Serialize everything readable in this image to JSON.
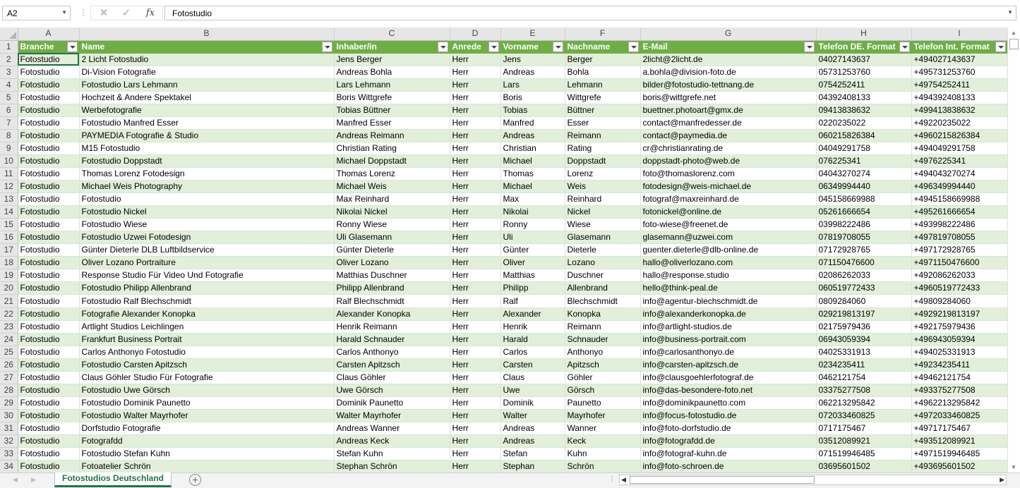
{
  "namebox": {
    "value": "A2"
  },
  "formula_bar": {
    "fx_label": "fx",
    "cancel_glyph": "✕",
    "enter_glyph": "✓",
    "value": "Fotostudio"
  },
  "columns": [
    "A",
    "B",
    "C",
    "D",
    "E",
    "F",
    "G",
    "H",
    "I"
  ],
  "header_row_number": "1",
  "headers": [
    "Branche",
    "Name",
    "Inhaber/in",
    "Anrede",
    "Vorname",
    "Nachname",
    "E-Mail",
    "Telefon DE. Format",
    "Telefon Int. Format"
  ],
  "rows": [
    {
      "n": "2",
      "c": [
        "Fotostudio",
        "2 Licht Fotostudio",
        "Jens Berger",
        "Herr",
        "Jens",
        "Berger",
        "2licht@2licht.de",
        "04027143637",
        "+494027143637"
      ]
    },
    {
      "n": "3",
      "c": [
        "Fotostudio",
        "Di-Vision Fotografie",
        "Andreas Bohla",
        "Herr",
        "Andreas",
        "Bohla",
        "a.bohla@division-foto.de",
        "05731253760",
        "+495731253760"
      ]
    },
    {
      "n": "4",
      "c": [
        "Fotostudio",
        "Fotostudio Lars Lehmann",
        "Lars Lehmann",
        "Herr",
        "Lars",
        "Lehmann",
        "bilder@fotostudio-tettnang.de",
        "0754252411",
        "+49754252411"
      ]
    },
    {
      "n": "5",
      "c": [
        "Fotostudio",
        "Hochzeit & Andere Spektakel",
        "Boris Wittgrefe",
        "Herr",
        "Boris",
        "Wittgrefe",
        "boris@wittgrefe.net",
        "04392408133",
        "+494392408133"
      ]
    },
    {
      "n": "6",
      "c": [
        "Fotostudio",
        "Werbefotografie",
        "Tobias Büttner",
        "Herr",
        "Tobias",
        "Büttner",
        "buettner.photoart@gmx.de",
        "09413838632",
        "+499413838632"
      ]
    },
    {
      "n": "7",
      "c": [
        "Fotostudio",
        "Fotostudio Manfred Esser",
        "Manfred Esser",
        "Herr",
        "Manfred",
        "Esser",
        "contact@manfredesser.de",
        "0220235022",
        "+49220235022"
      ]
    },
    {
      "n": "8",
      "c": [
        "Fotostudio",
        "PAYMEDIA Fotografie & Studio",
        "Andreas Reimann",
        "Herr",
        "Andreas",
        "Reimann",
        "contact@paymedia.de",
        "060215826384",
        "+4960215826384"
      ]
    },
    {
      "n": "9",
      "c": [
        "Fotostudio",
        "M15 Fotostudio",
        "Christian Rating",
        "Herr",
        "Christian",
        "Rating",
        "cr@christianrating.de",
        "04049291758",
        "+494049291758"
      ]
    },
    {
      "n": "10",
      "c": [
        "Fotostudio",
        "Fotostudio Doppstadt",
        "Michael Doppstadt",
        "Herr",
        "Michael",
        "Doppstadt",
        "doppstadt-photo@web.de",
        "076225341",
        "+4976225341"
      ]
    },
    {
      "n": "11",
      "c": [
        "Fotostudio",
        "Thomas Lorenz Fotodesign",
        "Thomas Lorenz",
        "Herr",
        "Thomas",
        "Lorenz",
        "foto@thomaslorenz.com",
        "04043270274",
        "+494043270274"
      ]
    },
    {
      "n": "12",
      "c": [
        "Fotostudio",
        "Michael Weis Photography",
        "Michael Weis",
        "Herr",
        "Michael",
        "Weis",
        "fotodesign@weis-michael.de",
        "06349994440",
        "+496349994440"
      ]
    },
    {
      "n": "13",
      "c": [
        "Fotostudio",
        "Fotostudio",
        "Max Reinhard",
        "Herr",
        "Max",
        "Reinhard",
        "fotograf@maxreinhard.de",
        "045158669988",
        "+4945158669988"
      ]
    },
    {
      "n": "14",
      "c": [
        "Fotostudio",
        "Fotostudio Nickel",
        "Nikolai Nickel",
        "Herr",
        "Nikolai",
        "Nickel",
        "fotonickel@online.de",
        "05261666654",
        "+495261666654"
      ]
    },
    {
      "n": "15",
      "c": [
        "Fotostudio",
        "Fotostudio Wiese",
        "Ronny Wiese",
        "Herr",
        "Ronny",
        "Wiese",
        "foto-wiese@freenet.de",
        "03998222486",
        "+493998222486"
      ]
    },
    {
      "n": "16",
      "c": [
        "Fotostudio",
        "Fotostudio Uzwei Fotodesign",
        "Uli Glasemann",
        "Herr",
        "Uli",
        "Glasemann",
        "glasemann@uzwei.com",
        "07819708055",
        "+497819708055"
      ]
    },
    {
      "n": "17",
      "c": [
        "Fotostudio",
        "Günter Dieterle DLB Luftbildservice",
        "Günter Dieterle",
        "Herr",
        "Günter",
        "Dieterle",
        "guenter.dieterle@dlb-online.de",
        "07172928765",
        "+497172928765"
      ]
    },
    {
      "n": "18",
      "c": [
        "Fotostudio",
        "Oliver Lozano Portraiture",
        "Oliver Lozano",
        "Herr",
        "Oliver",
        "Lozano",
        "hallo@oliverlozano.com",
        "071150476600",
        "+4971150476600"
      ]
    },
    {
      "n": "19",
      "c": [
        "Fotostudio",
        "Response Studio Für Video Und Fotografie",
        "Matthias Duschner",
        "Herr",
        "Matthias",
        "Duschner",
        "hallo@response.studio",
        "02086262033",
        "+492086262033"
      ]
    },
    {
      "n": "20",
      "c": [
        "Fotostudio",
        "Fotostudio Philipp Allenbrand",
        "Philipp Allenbrand",
        "Herr",
        "Philipp",
        "Allenbrand",
        "hello@think-peal.de",
        "060519772433",
        "+4960519772433"
      ]
    },
    {
      "n": "21",
      "c": [
        "Fotostudio",
        "Fotostudio Ralf Blechschmidt",
        "Ralf Blechschmidt",
        "Herr",
        "Ralf",
        "Blechschmidt",
        "info@agentur-blechschmidt.de",
        "0809284060",
        "+49809284060"
      ]
    },
    {
      "n": "22",
      "c": [
        "Fotostudio",
        "Fotografie Alexander Konopka",
        "Alexander Konopka",
        "Herr",
        "Alexander",
        "Konopka",
        "info@alexanderkonopka.de",
        "029219813197",
        "+4929219813197"
      ]
    },
    {
      "n": "23",
      "c": [
        "Fotostudio",
        "Artlight Studios Leichlingen",
        "Henrik Reimann",
        "Herr",
        "Henrik",
        "Reimann",
        "info@artlight-studios.de",
        "02175979436",
        "+492175979436"
      ]
    },
    {
      "n": "24",
      "c": [
        "Fotostudio",
        "Frankfurt Business Portrait",
        "Harald Schnauder",
        "Herr",
        "Harald",
        "Schnauder",
        "info@business-portrait.com",
        "06943059394",
        "+496943059394"
      ]
    },
    {
      "n": "25",
      "c": [
        "Fotostudio",
        "Carlos Anthonyo Fotostudio",
        "Carlos Anthonyo",
        "Herr",
        "Carlos",
        "Anthonyo",
        "info@carlosanthonyo.de",
        "04025331913",
        "+494025331913"
      ]
    },
    {
      "n": "26",
      "c": [
        "Fotostudio",
        "Fotostudio Carsten Apitzsch",
        "Carsten Apitzsch",
        "Herr",
        "Carsten",
        "Apitzsch",
        "info@carsten-apitzsch.de",
        "0234235411",
        "+49234235411"
      ]
    },
    {
      "n": "27",
      "c": [
        "Fotostudio",
        "Claus Göhler Studio Für Fotografie",
        "Claus Göhler",
        "Herr",
        "Claus",
        "Göhler",
        "info@clausgoehlerfotograf.de",
        "0462121754",
        "+49462121754"
      ]
    },
    {
      "n": "28",
      "c": [
        "Fotostudio",
        "Fotostudio Uwe Görsch",
        "Uwe Görsch",
        "Herr",
        "Uwe",
        "Görsch",
        "info@das-besondere-foto.net",
        "03375277508",
        "+493375277508"
      ]
    },
    {
      "n": "29",
      "c": [
        "Fotostudio",
        "Fotostudio Dominik Paunetto",
        "Dominik Paunetto",
        "Herr",
        "Dominik",
        "Paunetto",
        "info@dominikpaunetto.com",
        "062213295842",
        "+4962213295842"
      ]
    },
    {
      "n": "30",
      "c": [
        "Fotostudio",
        "Fotostudio Walter Mayrhofer",
        "Walter Mayrhofer",
        "Herr",
        "Walter",
        "Mayrhofer",
        "info@focus-fotostudio.de",
        "072033460825",
        "+4972033460825"
      ]
    },
    {
      "n": "31",
      "c": [
        "Fotostudio",
        "Dorfstudio Fotografie",
        "Andreas Wanner",
        "Herr",
        "Andreas",
        "Wanner",
        "info@foto-dorfstudio.de",
        "0717175467",
        "+49717175467"
      ]
    },
    {
      "n": "32",
      "c": [
        "Fotostudio",
        "Fotografdd",
        "Andreas Keck",
        "Herr",
        "Andreas",
        "Keck",
        "info@fotografdd.de",
        "03512089921",
        "+493512089921"
      ]
    },
    {
      "n": "33",
      "c": [
        "Fotostudio",
        "Fotostudio Stefan Kuhn",
        "Stefan Kuhn",
        "Herr",
        "Stefan",
        "Kuhn",
        "info@fotograf-kuhn.de",
        "071519946485",
        "+4971519946485"
      ]
    },
    {
      "n": "34",
      "c": [
        "Fotostudio",
        "Fotoatelier Schrön",
        "Stephan Schrön",
        "Herr",
        "Stephan",
        "Schrön",
        "info@foto-schroen.de",
        "03695601502",
        "+493695601502"
      ]
    }
  ],
  "sheet_tab": {
    "label": "Fotostudios Deutschland"
  },
  "add_sheet_glyph": "+",
  "colors": {
    "accent": "#217346",
    "header_fill": "#70ad47",
    "band_fill": "#e2efda"
  }
}
